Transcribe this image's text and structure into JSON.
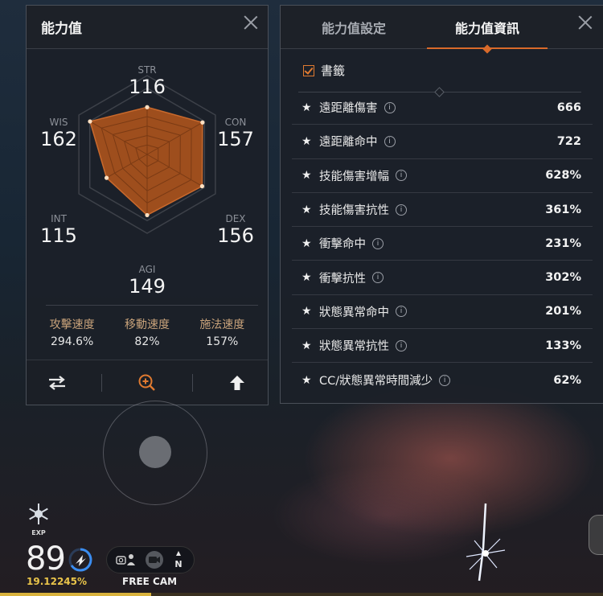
{
  "stats_panel": {
    "title": "能力值",
    "stats": {
      "str": {
        "name": "STR",
        "value": "116"
      },
      "con": {
        "name": "CON",
        "value": "157"
      },
      "dex": {
        "name": "DEX",
        "value": "156"
      },
      "agi": {
        "name": "AGI",
        "value": "149"
      },
      "int": {
        "name": "INT",
        "value": "115"
      },
      "wis": {
        "name": "WIS",
        "value": "162"
      }
    },
    "speeds": [
      {
        "label": "攻擊速度",
        "value": "294.6%"
      },
      {
        "label": "移動速度",
        "value": "82%"
      },
      {
        "label": "施法速度",
        "value": "157%"
      }
    ],
    "tool_icons": [
      "swap-icon",
      "zoom-in-icon",
      "upgrade-arrow-icon"
    ]
  },
  "info_panel": {
    "tabs": [
      {
        "label": "能力值設定",
        "active": false
      },
      {
        "label": "能力值資訊",
        "active": true
      }
    ],
    "bookmark_label": "書籤",
    "bookmark_checked": true,
    "rows": [
      {
        "name": "遠距離傷害",
        "value": "666"
      },
      {
        "name": "遠距離命中",
        "value": "722"
      },
      {
        "name": "技能傷害增幅",
        "value": "628%"
      },
      {
        "name": "技能傷害抗性",
        "value": "361%"
      },
      {
        "name": "衝擊命中",
        "value": "231%"
      },
      {
        "name": "衝擊抗性",
        "value": "302%"
      },
      {
        "name": "狀態異常命中",
        "value": "201%"
      },
      {
        "name": "狀態異常抗性",
        "value": "133%"
      },
      {
        "name": "CC/狀態異常時間減少",
        "value": "62%"
      }
    ]
  },
  "hud": {
    "exp_label": "EXP",
    "level": "89",
    "exp_percent": "19.12245%",
    "compass": "N",
    "cam_label": "FREE CAM"
  },
  "colors": {
    "accent": "#d96a2a",
    "radar_fill": "#a9521c",
    "speed_label": "#c8a27a",
    "exp_text": "#e9c44a"
  }
}
